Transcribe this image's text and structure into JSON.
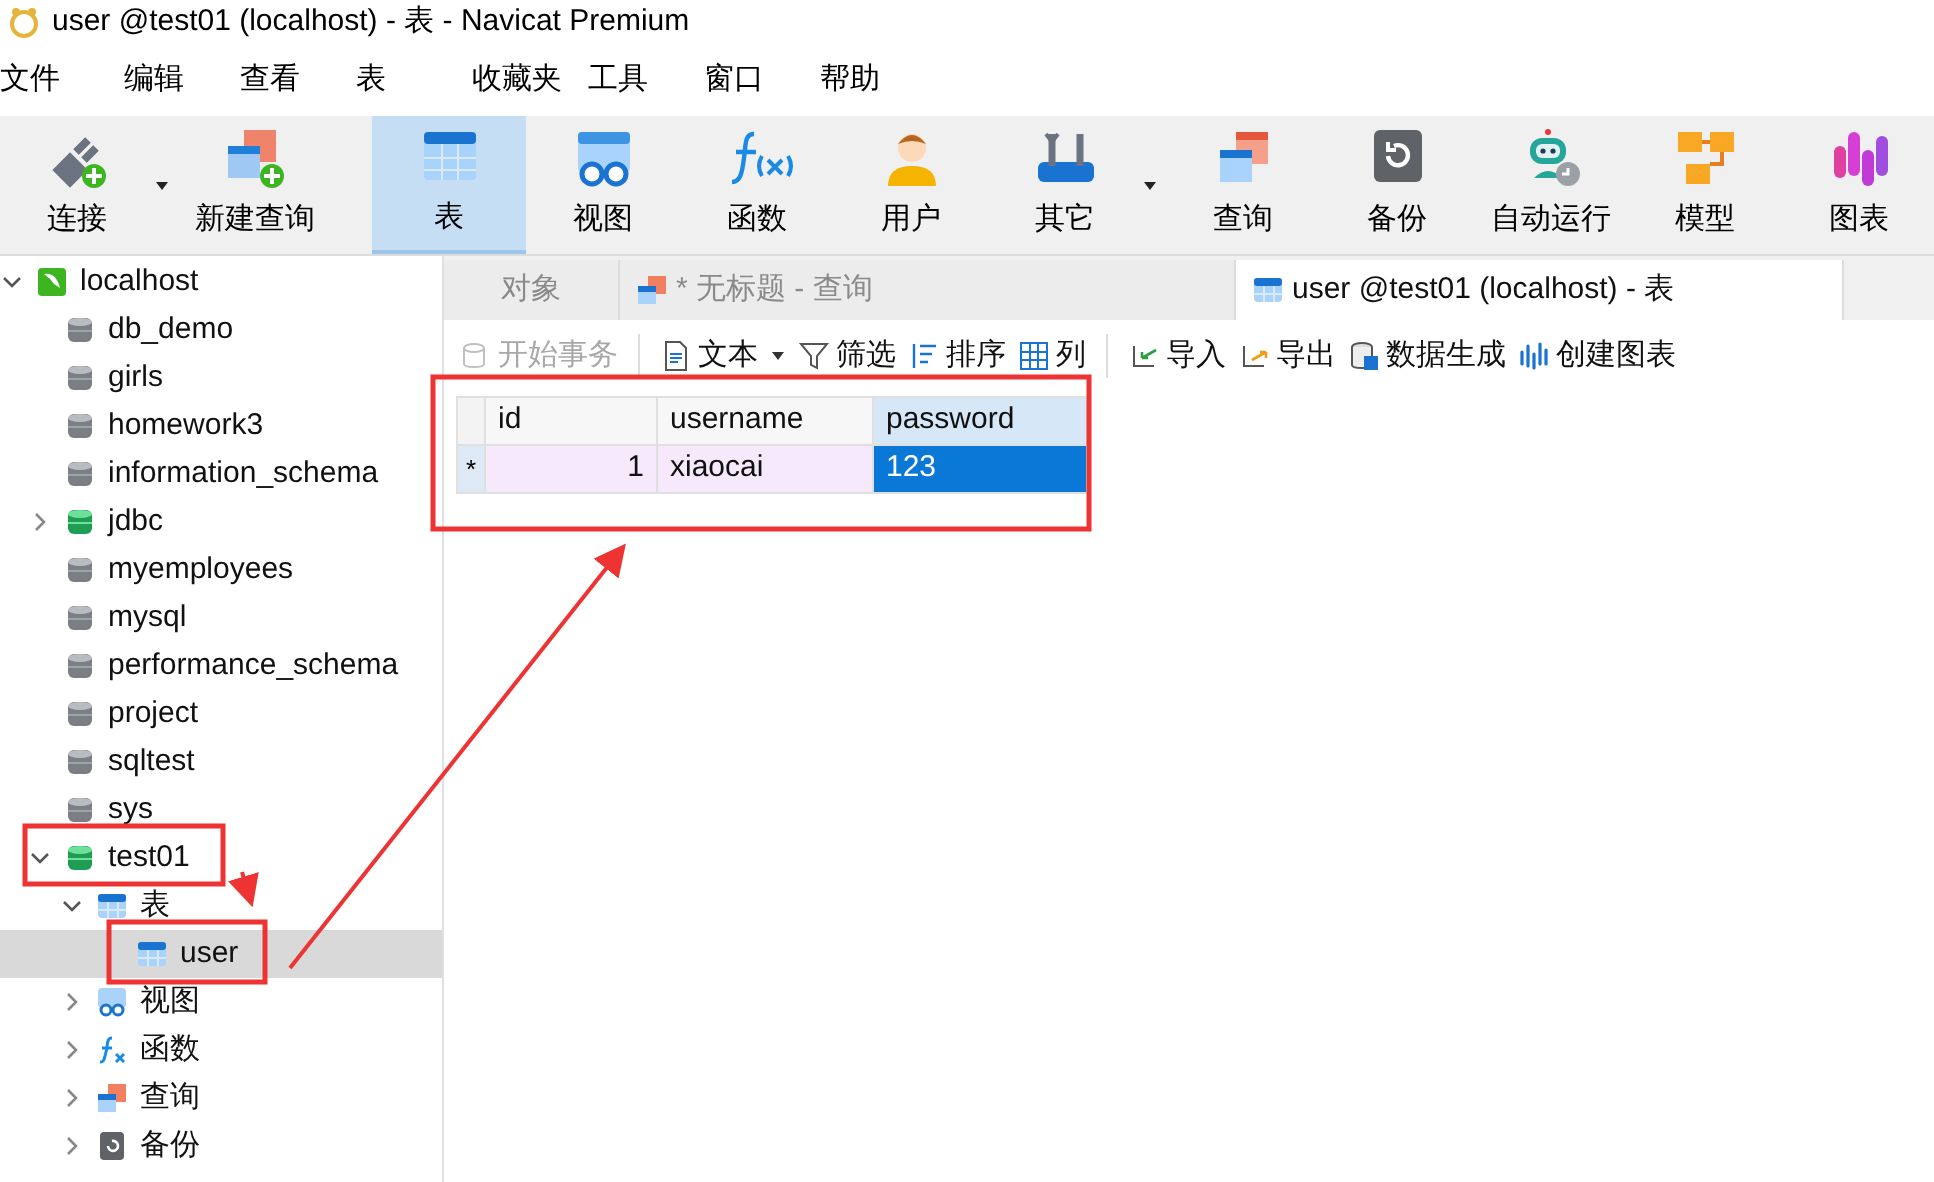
{
  "window": {
    "title": "user @test01 (localhost) - 表 - Navicat Premium"
  },
  "menu": [
    "文件",
    "编辑",
    "查看",
    "表",
    "收藏夹",
    "工具",
    "窗口",
    "帮助"
  ],
  "toolbar": [
    {
      "label": "连接",
      "kind": "connect",
      "selected": false,
      "dropdown": true
    },
    {
      "label": "新建查询",
      "kind": "new-query",
      "selected": false,
      "dropdown": false
    },
    {
      "label": "表",
      "kind": "table",
      "selected": true,
      "dropdown": false
    },
    {
      "label": "视图",
      "kind": "view",
      "selected": false,
      "dropdown": false
    },
    {
      "label": "函数",
      "kind": "function",
      "selected": false,
      "dropdown": false
    },
    {
      "label": "用户",
      "kind": "user",
      "selected": false,
      "dropdown": false
    },
    {
      "label": "其它",
      "kind": "tools",
      "selected": false,
      "dropdown": true
    },
    {
      "label": "查询",
      "kind": "query",
      "selected": false,
      "dropdown": false
    },
    {
      "label": "备份",
      "kind": "backup",
      "selected": false,
      "dropdown": false
    },
    {
      "label": "自动运行",
      "kind": "robot",
      "selected": false,
      "dropdown": false
    },
    {
      "label": "模型",
      "kind": "model",
      "selected": false,
      "dropdown": false
    },
    {
      "label": "图表",
      "kind": "chart",
      "selected": false,
      "dropdown": false
    }
  ],
  "sidebar": {
    "connection": {
      "label": "localhost",
      "expanded": true,
      "children": [
        {
          "label": "db_demo",
          "kind": "closed-db"
        },
        {
          "label": "girls",
          "kind": "closed-db"
        },
        {
          "label": "homework3",
          "kind": "closed-db"
        },
        {
          "label": "information_schema",
          "kind": "closed-db"
        },
        {
          "label": "jdbc",
          "kind": "open-db",
          "expanded": false
        },
        {
          "label": "myemployees",
          "kind": "closed-db"
        },
        {
          "label": "mysql",
          "kind": "closed-db"
        },
        {
          "label": "performance_schema",
          "kind": "closed-db"
        },
        {
          "label": "project",
          "kind": "closed-db"
        },
        {
          "label": "sqltest",
          "kind": "closed-db"
        },
        {
          "label": "sys",
          "kind": "closed-db"
        },
        {
          "label": "test01",
          "kind": "open-db",
          "expanded": true,
          "children": [
            {
              "label": "表",
              "kind": "table",
              "expanded": true,
              "children": [
                {
                  "label": "user",
                  "kind": "table",
                  "selected": true
                }
              ]
            },
            {
              "label": "视图",
              "kind": "view",
              "expanded": false
            },
            {
              "label": "函数",
              "kind": "function",
              "expanded": false
            },
            {
              "label": "查询",
              "kind": "query",
              "expanded": false
            },
            {
              "label": "备份",
              "kind": "backup",
              "expanded": false
            }
          ]
        }
      ]
    }
  },
  "tabs": [
    {
      "label": "对象",
      "kind": "objects",
      "selected": false
    },
    {
      "label": "* 无标题 - 查询",
      "kind": "query",
      "selected": false
    },
    {
      "label": "user @test01 (localhost) - 表",
      "kind": "table",
      "selected": true
    }
  ],
  "data_toolbar": [
    {
      "label": "开始事务",
      "kind": "transaction",
      "disabled": true,
      "dropdown": false
    },
    {
      "label": "文本",
      "kind": "text",
      "disabled": false,
      "dropdown": true
    },
    {
      "label": "筛选",
      "kind": "filter",
      "disabled": false,
      "dropdown": false
    },
    {
      "label": "排序",
      "kind": "sort",
      "disabled": false,
      "dropdown": false
    },
    {
      "label": "列",
      "kind": "columns",
      "disabled": false,
      "dropdown": false
    },
    {
      "label": "导入",
      "kind": "import",
      "disabled": false,
      "dropdown": false
    },
    {
      "label": "导出",
      "kind": "export",
      "disabled": false,
      "dropdown": false
    },
    {
      "label": "数据生成",
      "kind": "generate",
      "disabled": false,
      "dropdown": false
    },
    {
      "label": "创建图表",
      "kind": "chart",
      "disabled": false,
      "dropdown": false
    }
  ],
  "table": {
    "columns": [
      {
        "label": "id",
        "selected": false
      },
      {
        "label": "username",
        "selected": false
      },
      {
        "label": "password",
        "selected": true
      }
    ],
    "rows": [
      {
        "marker": "*",
        "current": true,
        "cells": [
          {
            "text": "1",
            "selected": false
          },
          {
            "text": "xiaocai",
            "selected": false
          },
          {
            "text": "123",
            "selected": true
          }
        ]
      }
    ]
  }
}
